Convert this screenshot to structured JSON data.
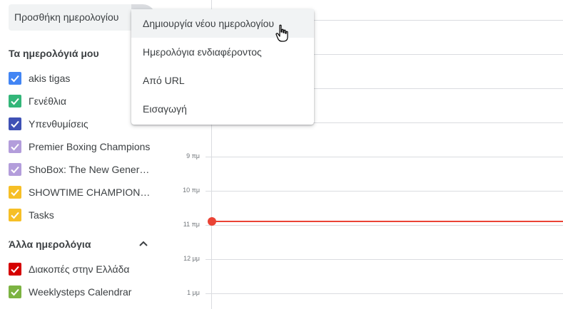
{
  "search": {
    "label": "Προσθήκη ημερολογίου"
  },
  "my_calendars": {
    "title": "Τα ημερολόγιά μου",
    "items": [
      {
        "label": "akis tigas",
        "color": "#4285f4"
      },
      {
        "label": "Γενέθλια",
        "color": "#33b679"
      },
      {
        "label": "Υπενθυμίσεις",
        "color": "#3f51b5"
      },
      {
        "label": "Premier Boxing Champions",
        "color": "#b39ddb"
      },
      {
        "label": "ShoBox: The New Generation",
        "color": "#b39ddb"
      },
      {
        "label": "SHOWTIME CHAMPIONSHIP BOXING",
        "color": "#f6bf26"
      },
      {
        "label": "Tasks",
        "color": "#f6bf26"
      }
    ]
  },
  "other_calendars": {
    "title": "Άλλα ημερολόγια",
    "items": [
      {
        "label": "Διακοπές στην Ελλάδα",
        "color": "#d50000"
      },
      {
        "label": "Weeklysteps Calendrar",
        "color": "#7cb342"
      }
    ]
  },
  "time_labels": [
    "9 πμ",
    "10 πμ",
    "11 πμ",
    "12 μμ",
    "1 μμ"
  ],
  "menu": {
    "items": [
      "Δημιουργία νέου ημερολογίου",
      "Ημερολόγια ενδιαφέροντος",
      "Από URL",
      "Εισαγωγή"
    ]
  },
  "colors": {
    "now_line": "#ea4335",
    "grid": "#dadce0"
  }
}
